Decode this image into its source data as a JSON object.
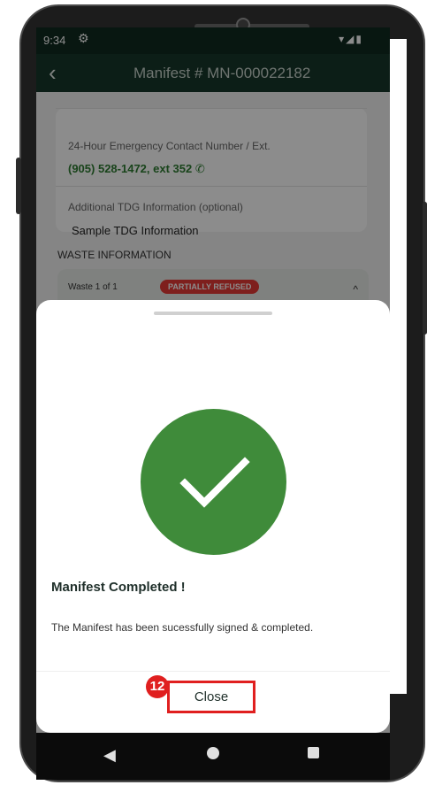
{
  "status_bar": {
    "time": "9:34",
    "gear_icon": "⚙",
    "signal_icons": "▾◢▮"
  },
  "app_bar": {
    "back_icon": "‹",
    "title": "Manifest # MN-000022182"
  },
  "card": {
    "emergency_label": "24-Hour Emergency Contact Number / Ext.",
    "emergency_value": "(905) 528-1472, ext 352",
    "phone_icon": "✆",
    "tdg_label": "Additional TDG Information (optional)",
    "tdg_value": "Sample TDG Information"
  },
  "waste_section": {
    "title": "WASTE INFORMATION",
    "waste_label": "Waste 1 of 1",
    "badge": "PARTIALLY REFUSED",
    "chevron": "^"
  },
  "sheet": {
    "title": "Manifest Completed !",
    "message": "The Manifest has been sucessfully signed & completed.",
    "close_label": "Close",
    "step_number": "12",
    "accent_color": "#3f8b3a",
    "highlight_color": "#e01f1f"
  },
  "nav_bar": {
    "back_icon": "◀"
  }
}
